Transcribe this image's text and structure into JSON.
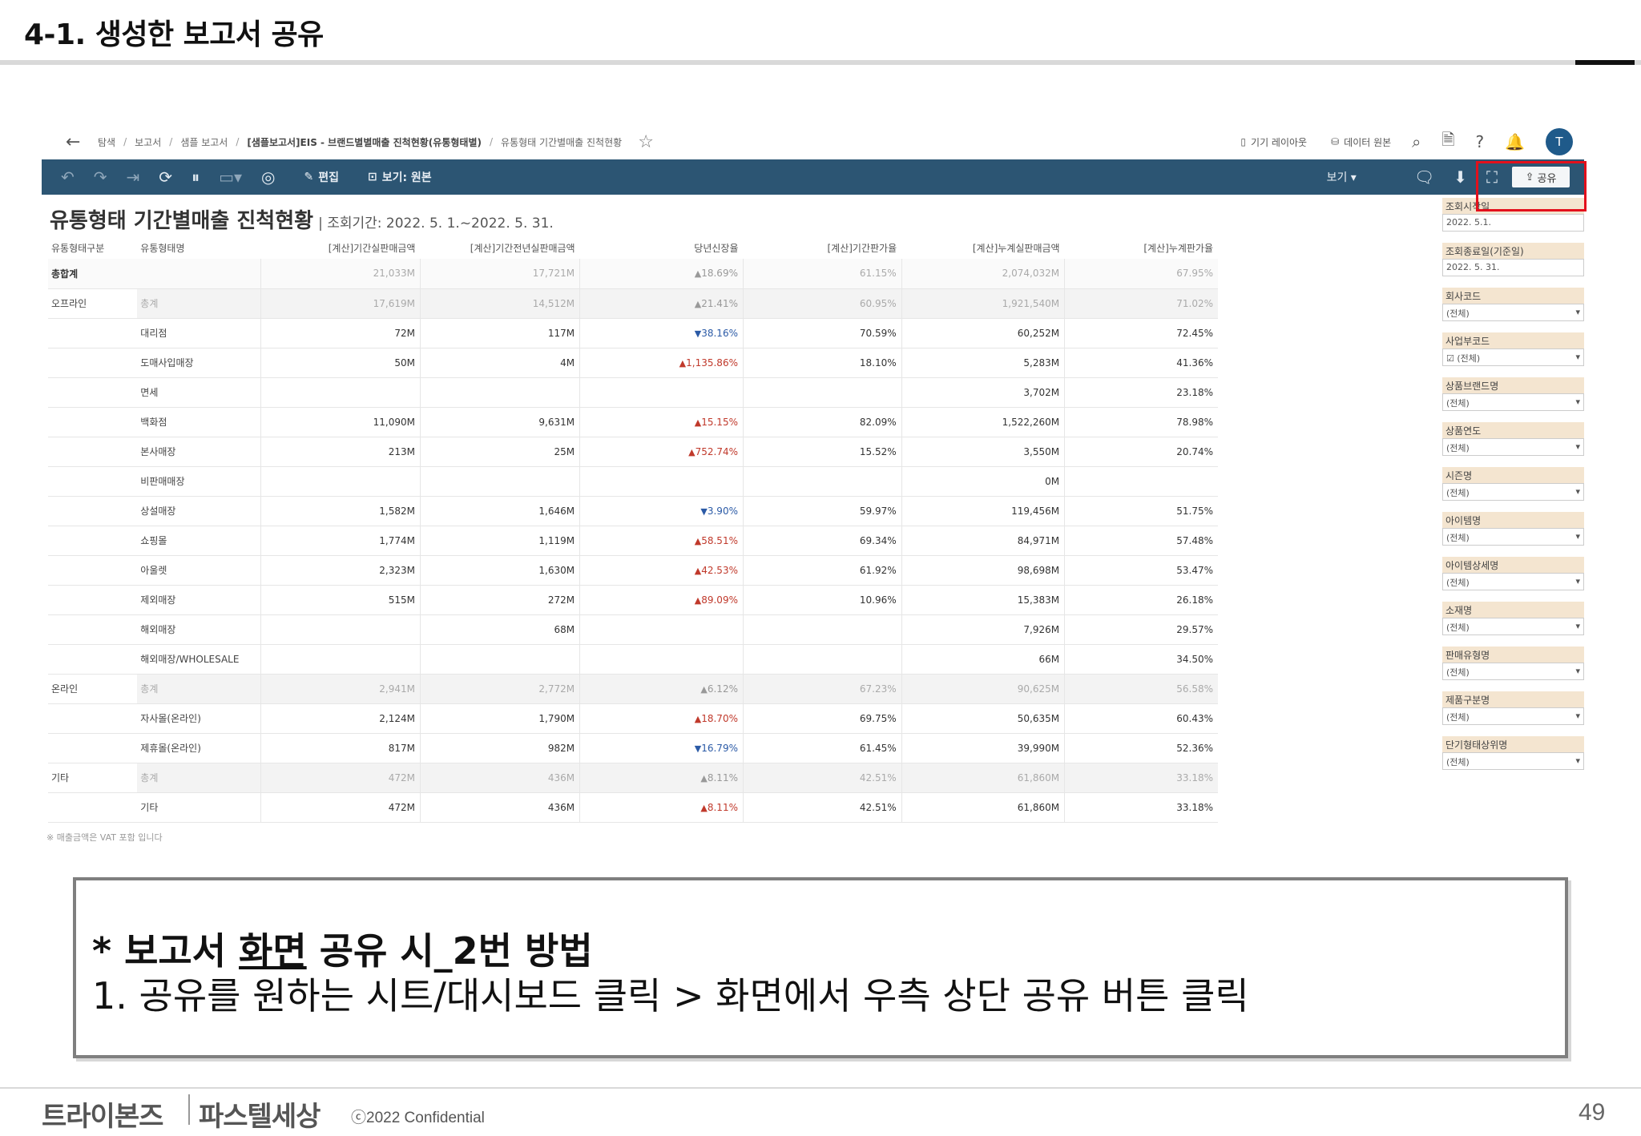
{
  "slide": {
    "title": "4-1. 생성한 보고서 공유",
    "callout_prefix": "* 보고서 ",
    "callout_underlined": "화면",
    "callout_suffix": " 공유 시_2번 방법",
    "callout_line2": "1. 공유를 원하는 시트/대시보드 클릭 > 화면에서 우측 상단 공유 버튼 클릭",
    "footer_logo1": "트라이본즈",
    "footer_logo2": "파스텔세상",
    "copyright": "ⓒ2022 Confidential",
    "page_number": "49"
  },
  "breadcrumb": {
    "items": [
      "탐색",
      "보고서",
      "샘플 보고서",
      "[샘플보고서]EIS - 브랜드별별매출 진척현황(유통형태별)",
      "유통형태 기간별매출 진척현황"
    ],
    "separator": "/"
  },
  "topbar": {
    "device_layout": "기기 레이아웃",
    "data_source": "데이터 원본",
    "avatar_initial": "T"
  },
  "toolbar": {
    "edit": "편집",
    "view_original": "보기: 원본",
    "view_menu": "보기 ▾",
    "share": "공유"
  },
  "report": {
    "title": "유통형태 기간별매출 진척현황",
    "period": "| 조회기간: 2022. 5. 1.~2022. 5. 31.",
    "footnote": "※ 매출금액은 VAT 포함 입니다",
    "columns": [
      "유통형태구분",
      "유통형태명",
      "[계산]기간실판매금액",
      "[계산]기간전년실판매금액",
      "당년신장율",
      "[계산]기간판가율",
      "[계산]누계실판매금액",
      "[계산]누계판가율"
    ],
    "rows": [
      {
        "type": "total",
        "c0": "총합계",
        "c1": "",
        "v1": "21,033M",
        "v2": "17,721M",
        "dir": "up",
        "growth": "18.69%",
        "v4": "61.15%",
        "v5": "2,074,032M",
        "v6": "67.95%"
      },
      {
        "type": "sub",
        "c0": "오프라인",
        "c1": "총계",
        "v1": "17,619M",
        "v2": "14,512M",
        "dir": "up",
        "growth": "21.41%",
        "v4": "60.95%",
        "v5": "1,921,540M",
        "v6": "71.02%"
      },
      {
        "type": "row",
        "c0": "",
        "c1": "대리점",
        "v1": "72M",
        "v2": "117M",
        "dir": "down",
        "growth": "38.16%",
        "v4": "70.59%",
        "v5": "60,252M",
        "v6": "72.45%"
      },
      {
        "type": "row",
        "c0": "",
        "c1": "도매사입매장",
        "v1": "50M",
        "v2": "4M",
        "dir": "up",
        "growth": "1,135.86%",
        "v4": "18.10%",
        "v5": "5,283M",
        "v6": "41.36%"
      },
      {
        "type": "row",
        "c0": "",
        "c1": "면세",
        "v1": "",
        "v2": "",
        "dir": "",
        "growth": "",
        "v4": "",
        "v5": "3,702M",
        "v6": "23.18%"
      },
      {
        "type": "row",
        "c0": "",
        "c1": "백화점",
        "v1": "11,090M",
        "v2": "9,631M",
        "dir": "up",
        "growth": "15.15%",
        "v4": "82.09%",
        "v5": "1,522,260M",
        "v6": "78.98%"
      },
      {
        "type": "row",
        "c0": "",
        "c1": "본사매장",
        "v1": "213M",
        "v2": "25M",
        "dir": "up",
        "growth": "752.74%",
        "v4": "15.52%",
        "v5": "3,550M",
        "v6": "20.74%"
      },
      {
        "type": "row",
        "c0": "",
        "c1": "비판매매장",
        "v1": "",
        "v2": "",
        "dir": "",
        "growth": "",
        "v4": "",
        "v5": "0M",
        "v6": ""
      },
      {
        "type": "row",
        "c0": "",
        "c1": "상설매장",
        "v1": "1,582M",
        "v2": "1,646M",
        "dir": "down",
        "growth": "3.90%",
        "v4": "59.97%",
        "v5": "119,456M",
        "v6": "51.75%"
      },
      {
        "type": "row",
        "c0": "",
        "c1": "쇼핑몰",
        "v1": "1,774M",
        "v2": "1,119M",
        "dir": "up",
        "growth": "58.51%",
        "v4": "69.34%",
        "v5": "84,971M",
        "v6": "57.48%"
      },
      {
        "type": "row",
        "c0": "",
        "c1": "아울렛",
        "v1": "2,323M",
        "v2": "1,630M",
        "dir": "up",
        "growth": "42.53%",
        "v4": "61.92%",
        "v5": "98,698M",
        "v6": "53.47%"
      },
      {
        "type": "row",
        "c0": "",
        "c1": "제외매장",
        "v1": "515M",
        "v2": "272M",
        "dir": "up",
        "growth": "89.09%",
        "v4": "10.96%",
        "v5": "15,383M",
        "v6": "26.18%"
      },
      {
        "type": "row",
        "c0": "",
        "c1": "해외매장",
        "v1": "",
        "v2": "68M",
        "dir": "",
        "growth": "",
        "v4": "",
        "v5": "7,926M",
        "v6": "29.57%"
      },
      {
        "type": "row",
        "c0": "",
        "c1": "해외매장/WHOLESALE",
        "v1": "",
        "v2": "",
        "dir": "",
        "growth": "",
        "v4": "",
        "v5": "66M",
        "v6": "34.50%"
      },
      {
        "type": "sub",
        "c0": "온라인",
        "c1": "총계",
        "v1": "2,941M",
        "v2": "2,772M",
        "dir": "up",
        "growth": "6.12%",
        "v4": "67.23%",
        "v5": "90,625M",
        "v6": "56.58%"
      },
      {
        "type": "row",
        "c0": "",
        "c1": "자사몰(온라인)",
        "v1": "2,124M",
        "v2": "1,790M",
        "dir": "up",
        "growth": "18.70%",
        "v4": "69.75%",
        "v5": "50,635M",
        "v6": "60.43%"
      },
      {
        "type": "row",
        "c0": "",
        "c1": "제휴몰(온라인)",
        "v1": "817M",
        "v2": "982M",
        "dir": "down",
        "growth": "16.79%",
        "v4": "61.45%",
        "v5": "39,990M",
        "v6": "52.36%"
      },
      {
        "type": "sub",
        "c0": "기타",
        "c1": "총계",
        "v1": "472M",
        "v2": "436M",
        "dir": "up",
        "growth": "8.11%",
        "v4": "42.51%",
        "v5": "61,860M",
        "v6": "33.18%"
      },
      {
        "type": "row",
        "c0": "",
        "c1": "기타",
        "v1": "472M",
        "v2": "436M",
        "dir": "up",
        "growth": "8.11%",
        "v4": "42.51%",
        "v5": "61,860M",
        "v6": "33.18%"
      }
    ]
  },
  "filters": [
    {
      "label": "조회시작일",
      "value": "2022. 5.1."
    },
    {
      "label": "조회종료일(기준일)",
      "value": "2022. 5. 31."
    },
    {
      "label": "회사코드",
      "value": "(전체)"
    },
    {
      "label": "사업부코드",
      "value": "☑ (전체)"
    },
    {
      "label": "상품브랜드명",
      "value": "(전체)"
    },
    {
      "label": "상품연도",
      "value": "(전체)"
    },
    {
      "label": "시즌명",
      "value": "(전체)"
    },
    {
      "label": "아이템명",
      "value": "(전체)"
    },
    {
      "label": "아이템상세명",
      "value": "(전체)"
    },
    {
      "label": "소재명",
      "value": "(전체)"
    },
    {
      "label": "판매유형명",
      "value": "(전체)"
    },
    {
      "label": "제품구분명",
      "value": "(전체)"
    },
    {
      "label": "단기형태상위명",
      "value": "(전체)"
    }
  ],
  "colors": {
    "toolbar": "#2c5573",
    "highlight": "#e3101c",
    "up": "#c0392b",
    "down": "#2b5aa6"
  }
}
